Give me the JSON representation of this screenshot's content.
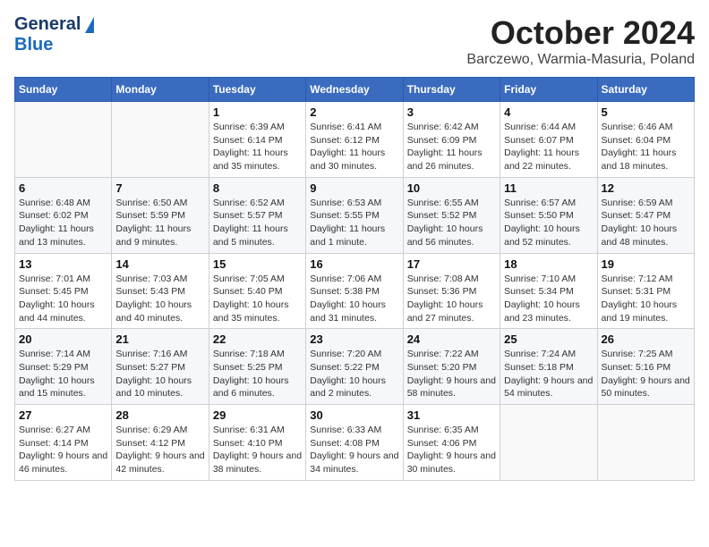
{
  "header": {
    "logo_general": "General",
    "logo_blue": "Blue",
    "title": "October 2024",
    "subtitle": "Barczewo, Warmia-Masuria, Poland"
  },
  "calendar": {
    "days_of_week": [
      "Sunday",
      "Monday",
      "Tuesday",
      "Wednesday",
      "Thursday",
      "Friday",
      "Saturday"
    ],
    "weeks": [
      [
        {
          "day": "",
          "info": ""
        },
        {
          "day": "",
          "info": ""
        },
        {
          "day": "1",
          "info": "Sunrise: 6:39 AM\nSunset: 6:14 PM\nDaylight: 11 hours and 35 minutes."
        },
        {
          "day": "2",
          "info": "Sunrise: 6:41 AM\nSunset: 6:12 PM\nDaylight: 11 hours and 30 minutes."
        },
        {
          "day": "3",
          "info": "Sunrise: 6:42 AM\nSunset: 6:09 PM\nDaylight: 11 hours and 26 minutes."
        },
        {
          "day": "4",
          "info": "Sunrise: 6:44 AM\nSunset: 6:07 PM\nDaylight: 11 hours and 22 minutes."
        },
        {
          "day": "5",
          "info": "Sunrise: 6:46 AM\nSunset: 6:04 PM\nDaylight: 11 hours and 18 minutes."
        }
      ],
      [
        {
          "day": "6",
          "info": "Sunrise: 6:48 AM\nSunset: 6:02 PM\nDaylight: 11 hours and 13 minutes."
        },
        {
          "day": "7",
          "info": "Sunrise: 6:50 AM\nSunset: 5:59 PM\nDaylight: 11 hours and 9 minutes."
        },
        {
          "day": "8",
          "info": "Sunrise: 6:52 AM\nSunset: 5:57 PM\nDaylight: 11 hours and 5 minutes."
        },
        {
          "day": "9",
          "info": "Sunrise: 6:53 AM\nSunset: 5:55 PM\nDaylight: 11 hours and 1 minute."
        },
        {
          "day": "10",
          "info": "Sunrise: 6:55 AM\nSunset: 5:52 PM\nDaylight: 10 hours and 56 minutes."
        },
        {
          "day": "11",
          "info": "Sunrise: 6:57 AM\nSunset: 5:50 PM\nDaylight: 10 hours and 52 minutes."
        },
        {
          "day": "12",
          "info": "Sunrise: 6:59 AM\nSunset: 5:47 PM\nDaylight: 10 hours and 48 minutes."
        }
      ],
      [
        {
          "day": "13",
          "info": "Sunrise: 7:01 AM\nSunset: 5:45 PM\nDaylight: 10 hours and 44 minutes."
        },
        {
          "day": "14",
          "info": "Sunrise: 7:03 AM\nSunset: 5:43 PM\nDaylight: 10 hours and 40 minutes."
        },
        {
          "day": "15",
          "info": "Sunrise: 7:05 AM\nSunset: 5:40 PM\nDaylight: 10 hours and 35 minutes."
        },
        {
          "day": "16",
          "info": "Sunrise: 7:06 AM\nSunset: 5:38 PM\nDaylight: 10 hours and 31 minutes."
        },
        {
          "day": "17",
          "info": "Sunrise: 7:08 AM\nSunset: 5:36 PM\nDaylight: 10 hours and 27 minutes."
        },
        {
          "day": "18",
          "info": "Sunrise: 7:10 AM\nSunset: 5:34 PM\nDaylight: 10 hours and 23 minutes."
        },
        {
          "day": "19",
          "info": "Sunrise: 7:12 AM\nSunset: 5:31 PM\nDaylight: 10 hours and 19 minutes."
        }
      ],
      [
        {
          "day": "20",
          "info": "Sunrise: 7:14 AM\nSunset: 5:29 PM\nDaylight: 10 hours and 15 minutes."
        },
        {
          "day": "21",
          "info": "Sunrise: 7:16 AM\nSunset: 5:27 PM\nDaylight: 10 hours and 10 minutes."
        },
        {
          "day": "22",
          "info": "Sunrise: 7:18 AM\nSunset: 5:25 PM\nDaylight: 10 hours and 6 minutes."
        },
        {
          "day": "23",
          "info": "Sunrise: 7:20 AM\nSunset: 5:22 PM\nDaylight: 10 hours and 2 minutes."
        },
        {
          "day": "24",
          "info": "Sunrise: 7:22 AM\nSunset: 5:20 PM\nDaylight: 9 hours and 58 minutes."
        },
        {
          "day": "25",
          "info": "Sunrise: 7:24 AM\nSunset: 5:18 PM\nDaylight: 9 hours and 54 minutes."
        },
        {
          "day": "26",
          "info": "Sunrise: 7:25 AM\nSunset: 5:16 PM\nDaylight: 9 hours and 50 minutes."
        }
      ],
      [
        {
          "day": "27",
          "info": "Sunrise: 6:27 AM\nSunset: 4:14 PM\nDaylight: 9 hours and 46 minutes."
        },
        {
          "day": "28",
          "info": "Sunrise: 6:29 AM\nSunset: 4:12 PM\nDaylight: 9 hours and 42 minutes."
        },
        {
          "day": "29",
          "info": "Sunrise: 6:31 AM\nSunset: 4:10 PM\nDaylight: 9 hours and 38 minutes."
        },
        {
          "day": "30",
          "info": "Sunrise: 6:33 AM\nSunset: 4:08 PM\nDaylight: 9 hours and 34 minutes."
        },
        {
          "day": "31",
          "info": "Sunrise: 6:35 AM\nSunset: 4:06 PM\nDaylight: 9 hours and 30 minutes."
        },
        {
          "day": "",
          "info": ""
        },
        {
          "day": "",
          "info": ""
        }
      ]
    ]
  }
}
